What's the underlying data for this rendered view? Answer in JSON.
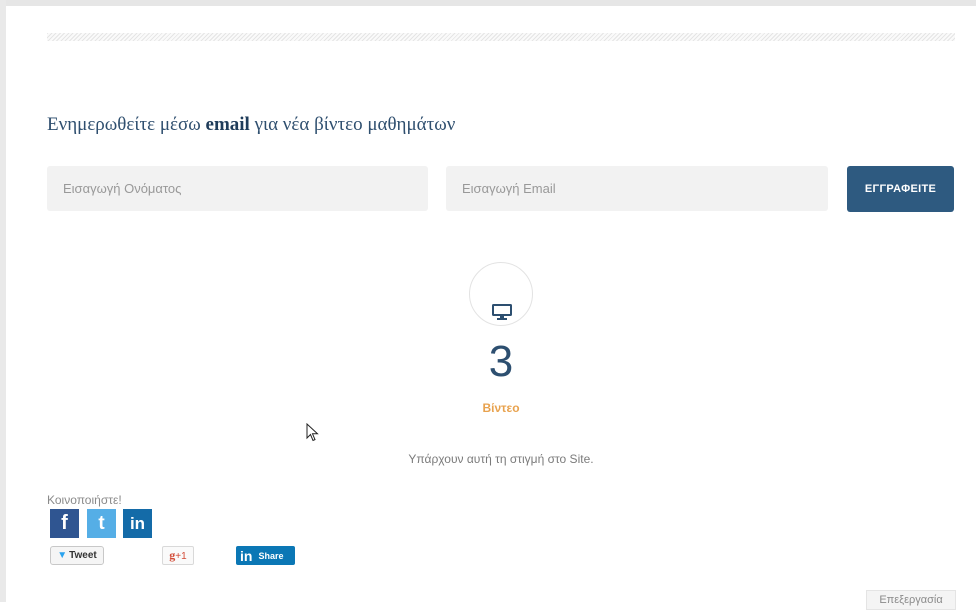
{
  "newsletter": {
    "heading_prefix": "Ενημερωθείτε μέσω",
    "heading_bold": "email",
    "heading_suffix": "για νέα βίντεο μαθημάτων",
    "name_placeholder": "Εισαγωγή Ονόματος",
    "email_placeholder": "Εισαγωγή Email",
    "subscribe_label": "ΕΓΓΡΑΦΕΙΤΕ"
  },
  "stats": {
    "icon": "monitor-icon",
    "count": "3",
    "label": "Βίντεο",
    "description": "Υπάρχουν αυτή τη στιγμή στο Site."
  },
  "share": {
    "title": "Κοινοποιήστε!",
    "facebook_glyph": "f",
    "twitter_glyph": "t",
    "linkedin_glyph": "in",
    "tweet_label": "Tweet",
    "gplus_g": "g",
    "gplus_label": "+1",
    "linkedin_in": "in",
    "linkedin_share_label": "Share"
  },
  "footer": {
    "more_label": "Επεξεργασία"
  },
  "colors": {
    "primary": "#2e5a80",
    "accent": "#e8a24e",
    "facebook": "#2f5591",
    "twitter": "#55aee6",
    "linkedin": "#146ba8"
  }
}
